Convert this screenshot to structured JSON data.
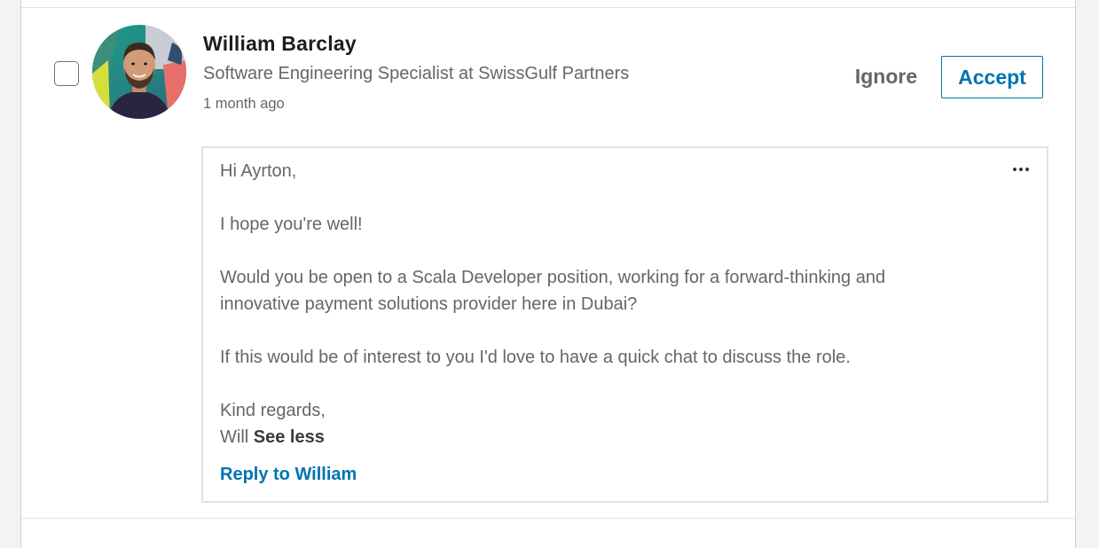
{
  "invitation": {
    "name": "William Barclay",
    "headline": "Software Engineering Specialist at SwissGulf Partners",
    "time_ago": "1 month ago",
    "actions": {
      "ignore_label": "Ignore",
      "accept_label": "Accept"
    },
    "message": {
      "greeting": "Hi Ayrton,",
      "line_1": "I hope you're well!",
      "line_2a": "Would you be open to a Scala Developer position, working for a forward-thinking and",
      "line_2b": "innovative payment solutions provider here in Dubai?",
      "line_3": "If this would be of interest to you I'd love to have a quick chat to discuss the role.",
      "closing": "Kind regards,",
      "signature": "Will",
      "see_less_label": "See less",
      "reply_label": "Reply to William",
      "more_icon": "more-horizontal-icon"
    }
  },
  "colors": {
    "accent": "#0073b1",
    "text_secondary": "#666666",
    "text_primary": "#1d1d1d",
    "page_background": "#f3f3f3"
  }
}
